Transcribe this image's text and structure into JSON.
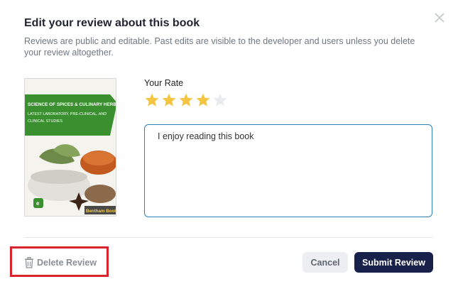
{
  "dialog": {
    "title": "Edit your review about this book",
    "subtitle": "Reviews are public and editable. Past edits are visible to the developer and users unless you delete your review altogether."
  },
  "book": {
    "cover_title": "SCIENCE OF SPICES & CULINARY HERBS",
    "cover_subtitle": "LATEST LABORATORY, PRE-CLINICAL, AND CLINICAL STUDIES",
    "publisher": "Bentham Books",
    "cover_accent": "#3a8f2f"
  },
  "rating": {
    "label": "Your Rate",
    "value": 4,
    "max": 5,
    "filled_color": "#f4c542",
    "empty_color": "#e9ecef"
  },
  "review": {
    "text": "I enjoy reading this book"
  },
  "footer": {
    "delete_label": "Delete Review",
    "cancel_label": "Cancel",
    "submit_label": "Submit Review"
  },
  "icons": [
    "close-icon",
    "trash-icon",
    "star-icon"
  ],
  "colors": {
    "focus_border": "#2f7fb8",
    "submit_bg": "#18214a",
    "highlight": "#d9232d"
  }
}
